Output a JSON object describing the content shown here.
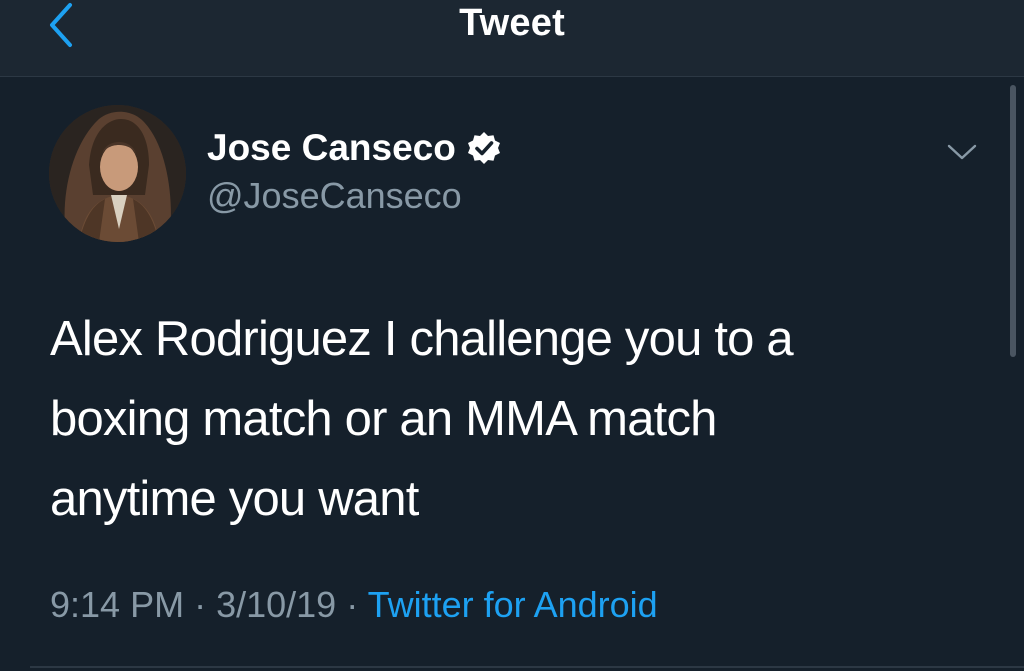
{
  "nav": {
    "title": "Tweet",
    "back_icon": "chevron-left-icon"
  },
  "tweet": {
    "author": {
      "display_name": "Jose Canseco",
      "username": "@JoseCanseco",
      "verified": true
    },
    "text_lines": [
      "Alex Rodriguez I challenge you to a",
      "boxing match or an MMA match",
      "anytime you want"
    ],
    "time": "9:14 PM",
    "date": "3/10/19",
    "separator": "·",
    "source": "Twitter for Android"
  },
  "colors": {
    "background": "#15202b",
    "nav_background": "#1c2732",
    "accent": "#1da1f2",
    "secondary_text": "#8899a6"
  }
}
